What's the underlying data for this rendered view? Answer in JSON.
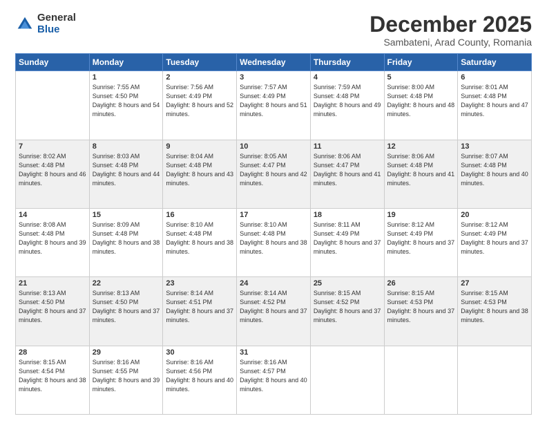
{
  "logo": {
    "general": "General",
    "blue": "Blue"
  },
  "title": "December 2025",
  "subtitle": "Sambateni, Arad County, Romania",
  "weekdays": [
    "Sunday",
    "Monday",
    "Tuesday",
    "Wednesday",
    "Thursday",
    "Friday",
    "Saturday"
  ],
  "weeks": [
    [
      {
        "day": "",
        "sunrise": "",
        "sunset": "",
        "daylight": ""
      },
      {
        "day": "1",
        "sunrise": "Sunrise: 7:55 AM",
        "sunset": "Sunset: 4:50 PM",
        "daylight": "Daylight: 8 hours and 54 minutes."
      },
      {
        "day": "2",
        "sunrise": "Sunrise: 7:56 AM",
        "sunset": "Sunset: 4:49 PM",
        "daylight": "Daylight: 8 hours and 52 minutes."
      },
      {
        "day": "3",
        "sunrise": "Sunrise: 7:57 AM",
        "sunset": "Sunset: 4:49 PM",
        "daylight": "Daylight: 8 hours and 51 minutes."
      },
      {
        "day": "4",
        "sunrise": "Sunrise: 7:59 AM",
        "sunset": "Sunset: 4:48 PM",
        "daylight": "Daylight: 8 hours and 49 minutes."
      },
      {
        "day": "5",
        "sunrise": "Sunrise: 8:00 AM",
        "sunset": "Sunset: 4:48 PM",
        "daylight": "Daylight: 8 hours and 48 minutes."
      },
      {
        "day": "6",
        "sunrise": "Sunrise: 8:01 AM",
        "sunset": "Sunset: 4:48 PM",
        "daylight": "Daylight: 8 hours and 47 minutes."
      }
    ],
    [
      {
        "day": "7",
        "sunrise": "Sunrise: 8:02 AM",
        "sunset": "Sunset: 4:48 PM",
        "daylight": "Daylight: 8 hours and 46 minutes."
      },
      {
        "day": "8",
        "sunrise": "Sunrise: 8:03 AM",
        "sunset": "Sunset: 4:48 PM",
        "daylight": "Daylight: 8 hours and 44 minutes."
      },
      {
        "day": "9",
        "sunrise": "Sunrise: 8:04 AM",
        "sunset": "Sunset: 4:48 PM",
        "daylight": "Daylight: 8 hours and 43 minutes."
      },
      {
        "day": "10",
        "sunrise": "Sunrise: 8:05 AM",
        "sunset": "Sunset: 4:47 PM",
        "daylight": "Daylight: 8 hours and 42 minutes."
      },
      {
        "day": "11",
        "sunrise": "Sunrise: 8:06 AM",
        "sunset": "Sunset: 4:47 PM",
        "daylight": "Daylight: 8 hours and 41 minutes."
      },
      {
        "day": "12",
        "sunrise": "Sunrise: 8:06 AM",
        "sunset": "Sunset: 4:48 PM",
        "daylight": "Daylight: 8 hours and 41 minutes."
      },
      {
        "day": "13",
        "sunrise": "Sunrise: 8:07 AM",
        "sunset": "Sunset: 4:48 PM",
        "daylight": "Daylight: 8 hours and 40 minutes."
      }
    ],
    [
      {
        "day": "14",
        "sunrise": "Sunrise: 8:08 AM",
        "sunset": "Sunset: 4:48 PM",
        "daylight": "Daylight: 8 hours and 39 minutes."
      },
      {
        "day": "15",
        "sunrise": "Sunrise: 8:09 AM",
        "sunset": "Sunset: 4:48 PM",
        "daylight": "Daylight: 8 hours and 38 minutes."
      },
      {
        "day": "16",
        "sunrise": "Sunrise: 8:10 AM",
        "sunset": "Sunset: 4:48 PM",
        "daylight": "Daylight: 8 hours and 38 minutes."
      },
      {
        "day": "17",
        "sunrise": "Sunrise: 8:10 AM",
        "sunset": "Sunset: 4:48 PM",
        "daylight": "Daylight: 8 hours and 38 minutes."
      },
      {
        "day": "18",
        "sunrise": "Sunrise: 8:11 AM",
        "sunset": "Sunset: 4:49 PM",
        "daylight": "Daylight: 8 hours and 37 minutes."
      },
      {
        "day": "19",
        "sunrise": "Sunrise: 8:12 AM",
        "sunset": "Sunset: 4:49 PM",
        "daylight": "Daylight: 8 hours and 37 minutes."
      },
      {
        "day": "20",
        "sunrise": "Sunrise: 8:12 AM",
        "sunset": "Sunset: 4:49 PM",
        "daylight": "Daylight: 8 hours and 37 minutes."
      }
    ],
    [
      {
        "day": "21",
        "sunrise": "Sunrise: 8:13 AM",
        "sunset": "Sunset: 4:50 PM",
        "daylight": "Daylight: 8 hours and 37 minutes."
      },
      {
        "day": "22",
        "sunrise": "Sunrise: 8:13 AM",
        "sunset": "Sunset: 4:50 PM",
        "daylight": "Daylight: 8 hours and 37 minutes."
      },
      {
        "day": "23",
        "sunrise": "Sunrise: 8:14 AM",
        "sunset": "Sunset: 4:51 PM",
        "daylight": "Daylight: 8 hours and 37 minutes."
      },
      {
        "day": "24",
        "sunrise": "Sunrise: 8:14 AM",
        "sunset": "Sunset: 4:52 PM",
        "daylight": "Daylight: 8 hours and 37 minutes."
      },
      {
        "day": "25",
        "sunrise": "Sunrise: 8:15 AM",
        "sunset": "Sunset: 4:52 PM",
        "daylight": "Daylight: 8 hours and 37 minutes."
      },
      {
        "day": "26",
        "sunrise": "Sunrise: 8:15 AM",
        "sunset": "Sunset: 4:53 PM",
        "daylight": "Daylight: 8 hours and 37 minutes."
      },
      {
        "day": "27",
        "sunrise": "Sunrise: 8:15 AM",
        "sunset": "Sunset: 4:53 PM",
        "daylight": "Daylight: 8 hours and 38 minutes."
      }
    ],
    [
      {
        "day": "28",
        "sunrise": "Sunrise: 8:15 AM",
        "sunset": "Sunset: 4:54 PM",
        "daylight": "Daylight: 8 hours and 38 minutes."
      },
      {
        "day": "29",
        "sunrise": "Sunrise: 8:16 AM",
        "sunset": "Sunset: 4:55 PM",
        "daylight": "Daylight: 8 hours and 39 minutes."
      },
      {
        "day": "30",
        "sunrise": "Sunrise: 8:16 AM",
        "sunset": "Sunset: 4:56 PM",
        "daylight": "Daylight: 8 hours and 40 minutes."
      },
      {
        "day": "31",
        "sunrise": "Sunrise: 8:16 AM",
        "sunset": "Sunset: 4:57 PM",
        "daylight": "Daylight: 8 hours and 40 minutes."
      },
      {
        "day": "",
        "sunrise": "",
        "sunset": "",
        "daylight": ""
      },
      {
        "day": "",
        "sunrise": "",
        "sunset": "",
        "daylight": ""
      },
      {
        "day": "",
        "sunrise": "",
        "sunset": "",
        "daylight": ""
      }
    ]
  ]
}
